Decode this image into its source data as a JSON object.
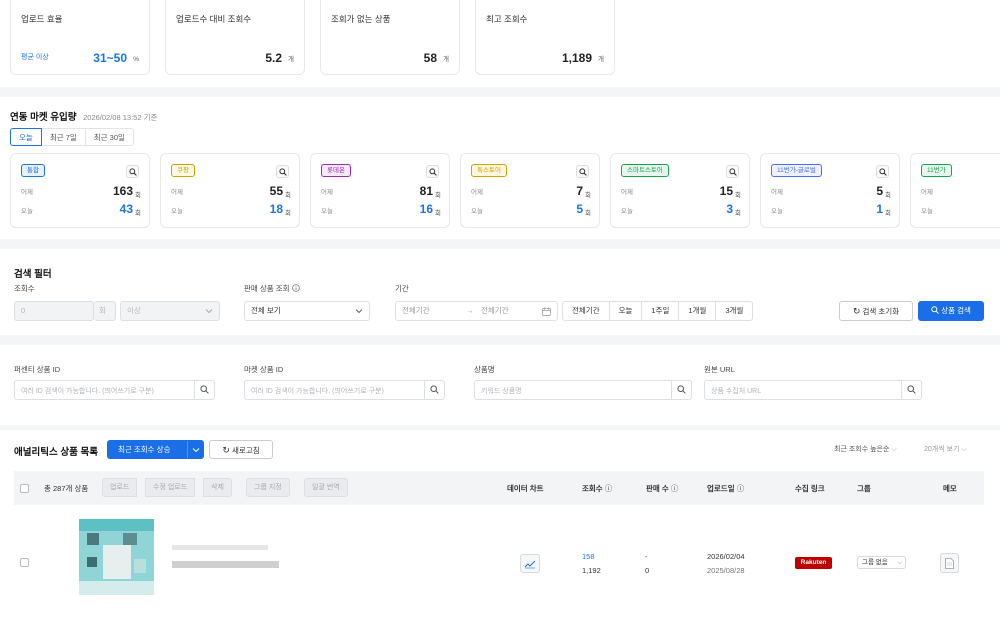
{
  "stats": [
    {
      "title": "업로드 효율",
      "sub": "평균 이상",
      "value": "31~50",
      "unit": "%"
    },
    {
      "title": "업로드수 대비 조회수",
      "value": "5.2",
      "unit": "개"
    },
    {
      "title": "조회가 없는 상품",
      "value": "58",
      "unit": "개"
    },
    {
      "title": "최고 조회수",
      "value": "1,189",
      "unit": "개"
    }
  ],
  "market": {
    "title": "연동 마켓 유입량",
    "timestamp": "2026/02/08 13:52 기준",
    "tabs": [
      "오늘",
      "최근 7일",
      "최근 30일"
    ],
    "yesterday_label": "어제",
    "today_label": "오늘",
    "unit": "회",
    "cards": [
      {
        "name": "통합",
        "yesterday": "163",
        "today": "43",
        "color": "#1a73e8",
        "bg": "#e8f0fd"
      },
      {
        "name": "쿠팡",
        "yesterday": "55",
        "today": "18",
        "color": "#c9a400",
        "bg": "#fdf9e4"
      },
      {
        "name": "롯데온",
        "yesterday": "81",
        "today": "16",
        "color": "#9c27b0",
        "bg": "#f6e9f9"
      },
      {
        "name": "톡스토어",
        "yesterday": "7",
        "today": "5",
        "color": "#d4a200",
        "bg": "#fff8df"
      },
      {
        "name": "스마트스토어",
        "yesterday": "15",
        "today": "3",
        "color": "#16a34a",
        "bg": "#e8f7ee"
      },
      {
        "name": "11번가-글로벌",
        "yesterday": "5",
        "today": "1",
        "color": "#4a6cf7",
        "bg": "#eef1fe"
      },
      {
        "name": "11번가",
        "yesterday": "",
        "today": "",
        "color": "#16a34a",
        "bg": "#e8f7ee"
      }
    ]
  },
  "filter": {
    "title": "검색 필터",
    "views_label": "조회수",
    "views_value": "0",
    "views_unit": "회",
    "views_cond": "이상",
    "sales_label": "판매 상품 조회",
    "sales_value": "전체 보기",
    "period_label": "기간",
    "start_ph": "전체기간",
    "end_ph": "전체기간",
    "period_buttons": [
      "전체기간",
      "오늘",
      "1주일",
      "1개월",
      "3개월"
    ],
    "reset_label": "검색 초기화",
    "search_label": "상품 검색"
  },
  "id_search": [
    {
      "label": "퍼센티 상품 ID",
      "placeholder": "여러 ID 검색이 가능합니다. (띄어쓰기로 구분)"
    },
    {
      "label": "마켓 상품 ID",
      "placeholder": "여러 ID 검색이 가능합니다. (띄어쓰기로 구분)"
    },
    {
      "label": "상품명",
      "placeholder": "키워드 상품명"
    },
    {
      "label": "원본 URL",
      "placeholder": "상품 수집처 URL"
    }
  ],
  "list": {
    "title": "애널리틱스 상품 목록",
    "sort_button": "최근 조회수 상승",
    "refresh_label": "새로고침",
    "sort_select": "최근 조회수 높은순",
    "per_page": "20개씩 보기",
    "total": "총 287개 상품",
    "bulk_buttons": [
      "업로드",
      "수정 업로드",
      "삭제",
      "그룹 지정",
      "일괄 번역"
    ],
    "columns": {
      "chart": "데이터 차트",
      "views": "조회수",
      "sales": "판매 수",
      "upload": "업로드일",
      "link": "수집 링크",
      "group": "그룹",
      "memo": "메모"
    },
    "rows": [
      {
        "views_recent": "158",
        "views_total": "1,192",
        "sales_recent": "-",
        "sales_total": "0",
        "upload_date": "2026/02/04",
        "collect_date": "2025/08/28",
        "source": "Rakuten",
        "group": "그룹 없음"
      }
    ]
  }
}
